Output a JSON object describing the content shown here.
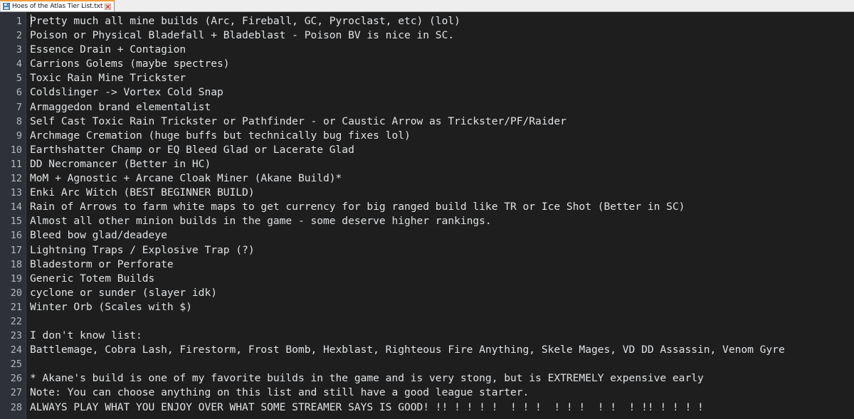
{
  "window": {
    "app": "Notepad++",
    "background_color": "#1e1e1e",
    "gutter_color": "#2e3238",
    "text_color": "#dfe2e5",
    "accent_color": "#ee9d3a"
  },
  "tabbar": {
    "tabs": [
      {
        "title": "Hoes of the Atlas Tier List.txt",
        "active": true,
        "save_icon": "save-icon",
        "close_icon": "close-icon"
      }
    ]
  },
  "editor": {
    "line_numbers": [
      1,
      2,
      3,
      4,
      5,
      6,
      7,
      8,
      9,
      10,
      11,
      12,
      13,
      14,
      15,
      16,
      17,
      18,
      19,
      20,
      21,
      22,
      23,
      24,
      25,
      26,
      27,
      28
    ],
    "lines": [
      "Pretty much all mine builds (Arc, Fireball, GC, Pyroclast, etc) (lol)",
      "Poison or Physical Bladefall + Bladeblast - Poison BV is nice in SC.",
      "Essence Drain + Contagion",
      "Carrions Golems (maybe spectres)",
      "Toxic Rain Mine Trickster",
      "Coldslinger -> Vortex Cold Snap",
      "Armaggedon brand elementalist",
      "Self Cast Toxic Rain Trickster or Pathfinder - or Caustic Arrow as Trickster/PF/Raider",
      "Archmage Cremation (huge buffs but technically bug fixes lol)",
      "Earthshatter Champ or EQ Bleed Glad or Lacerate Glad",
      "DD Necromancer (Better in HC)",
      "MoM + Agnostic + Arcane Cloak Miner (Akane Build)*",
      "Enki Arc Witch (BEST BEGINNER BUILD)",
      "Rain of Arrows to farm white maps to get currency for big ranged build like TR or Ice Shot (Better in SC)",
      "Almost all other minion builds in the game - some deserve higher rankings.",
      "Bleed bow glad/deadeye",
      "Lightning Traps / Explosive Trap (?)",
      "Bladestorm or Perforate",
      "Generic Totem Builds",
      "cyclone or sunder (slayer idk)",
      "Winter Orb (Scales with $)",
      "",
      "I don't know list:",
      "Battlemage, Cobra Lash, Firestorm, Frost Bomb, Hexblast, Righteous Fire Anything, Skele Mages, VD DD Assassin, Venom Gyre",
      "",
      "* Akane's build is one of my favorite builds in the game and is very stong, but is EXTREMELY expensive early",
      "Note: You can choose anything on this list and still have a good league starter.",
      "ALWAYS PLAY WHAT YOU ENJOY OVER WHAT SOME STREAMER SAYS IS GOOD! !! ! ! ! !  ! ! !  ! ! !  ! !  ! !! ! ! ! !"
    ]
  }
}
